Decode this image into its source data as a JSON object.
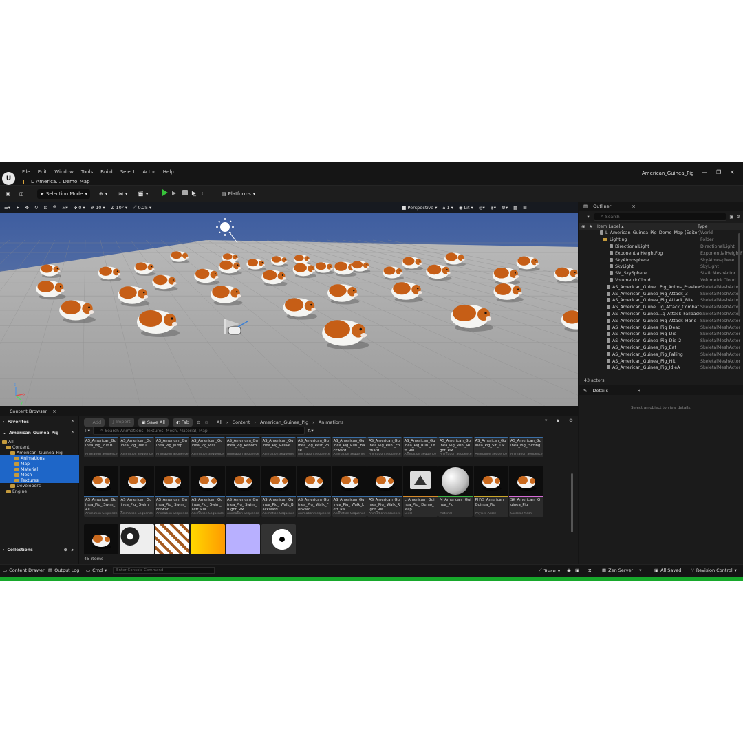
{
  "app": {
    "logo": "U",
    "menu": [
      "File",
      "Edit",
      "Window",
      "Tools",
      "Build",
      "Select",
      "Actor",
      "Help"
    ],
    "map_tab": "L_America..._Demo_Map",
    "window_title": "American_Guinea_Pig",
    "window_controls": [
      "—",
      "❐",
      "✕"
    ]
  },
  "toolbar": {
    "selection_mode": "Selection Mode",
    "platforms": "Platforms"
  },
  "viewport": {
    "snap_rotate": "0",
    "snap_grid": "10",
    "snap_angle": "10°",
    "snap_scale": "0.25",
    "perspective": "Perspective",
    "lit": "Lit",
    "camera_speed": "1"
  },
  "outliner": {
    "tab": "Outliner",
    "search_placeholder": "Search",
    "col_label": "Item Label ▴",
    "col_type": "Type",
    "rows": [
      {
        "label": "L_American_Guinea_Pig_Demo_Map (Editor)",
        "type": "World",
        "indent": 0
      },
      {
        "label": "Lighting",
        "type": "Folder",
        "indent": 1
      },
      {
        "label": "DirectionalLight",
        "type": "DirectionalLight",
        "indent": 2
      },
      {
        "label": "ExponentialHeightFog",
        "type": "ExponentialHeightF",
        "indent": 2
      },
      {
        "label": "SkyAtmosphere",
        "type": "SkyAtmosphere",
        "indent": 2
      },
      {
        "label": "SkyLight",
        "type": "SkyLight",
        "indent": 2
      },
      {
        "label": "SM_SkySphere",
        "type": "StaticMeshActor",
        "indent": 2
      },
      {
        "label": "VolumetricCloud",
        "type": "VolumetricCloud",
        "indent": 2
      },
      {
        "label": "AS_American_Guine...Pig_Anims_Preview",
        "type": "SkeletalMeshActor",
        "indent": 1
      },
      {
        "label": "AS_American_Guinea_Pig_Attack_3",
        "type": "SkeletalMeshActor",
        "indent": 1
      },
      {
        "label": "AS_American_Guinea_Pig_Attack_Bite",
        "type": "SkeletalMeshActor",
        "indent": 1
      },
      {
        "label": "AS_American_Guine...ig_Attack_Combat",
        "type": "SkeletalMeshActor",
        "indent": 1
      },
      {
        "label": "AS_American_Guinea...g_Attack_Fallback",
        "type": "SkeletalMeshActor",
        "indent": 1
      },
      {
        "label": "AS_American_Guinea_Pig_Attack_Hand",
        "type": "SkeletalMeshActor",
        "indent": 1
      },
      {
        "label": "AS_American_Guinea_Pig_Dead",
        "type": "SkeletalMeshActor",
        "indent": 1
      },
      {
        "label": "AS_American_Guinea_Pig_Die",
        "type": "SkeletalMeshActor",
        "indent": 1
      },
      {
        "label": "AS_American_Guinea_Pig_Die_2",
        "type": "SkeletalMeshActor",
        "indent": 1
      },
      {
        "label": "AS_American_Guinea_Pig_Eat",
        "type": "SkeletalMeshActor",
        "indent": 1
      },
      {
        "label": "AS_American_Guinea_Pig_Falling",
        "type": "SkeletalMeshActor",
        "indent": 1
      },
      {
        "label": "AS_American_Guinea_Pig_Hit",
        "type": "SkeletalMeshActor",
        "indent": 1
      },
      {
        "label": "AS_American_Guinea_Pig_IdleA",
        "type": "SkeletalMeshActor",
        "indent": 1
      }
    ],
    "count": "43 actors"
  },
  "details": {
    "tab": "Details",
    "empty_text": "Select an object to view details."
  },
  "content_browser": {
    "tab": "Content Browser",
    "add": "Add",
    "import": "Import",
    "save_all": "Save All",
    "fab": "Fab",
    "breadcrumb": [
      "All",
      "Content",
      "American_Guinea_Pig",
      "Animations"
    ],
    "search_placeholder": "Search Animations, Textures, Mesh, Material, Map",
    "favorites": "Favorites",
    "project": "American_Guinea_Pig",
    "tree": [
      {
        "label": "All",
        "indent": 0,
        "sel": false
      },
      {
        "label": "Content",
        "indent": 1,
        "sel": false
      },
      {
        "label": "American_Guinea_Pig",
        "indent": 2,
        "sel": false
      },
      {
        "label": "Animations",
        "indent": 3,
        "sel": true
      },
      {
        "label": "Map",
        "indent": 3,
        "sel": true
      },
      {
        "label": "Material",
        "indent": 3,
        "sel": true
      },
      {
        "label": "Mesh",
        "indent": 3,
        "sel": true
      },
      {
        "label": "Textures",
        "indent": 3,
        "sel": true
      },
      {
        "label": "Developers",
        "indent": 2,
        "sel": false
      },
      {
        "label": "Engine",
        "indent": 1,
        "sel": false
      }
    ],
    "collections": "Collections",
    "item_count": "45 items",
    "row1": [
      {
        "name": "AS_American_Guinea_Pig_Idle B",
        "type": "Animation Sequence"
      },
      {
        "name": "AS_American_Guinea_Pig_Idle C",
        "type": "Animation Sequence"
      },
      {
        "name": "AS_American_Guinea_Pig_Jump",
        "type": "Animation Sequence"
      },
      {
        "name": "AS_American_Guinea_Pig_Piss",
        "type": "Animation Sequence"
      },
      {
        "name": "AS_American_Guinea_Pig_Reborn",
        "type": "Animation Sequence"
      },
      {
        "name": "AS_American_Guinea_Pig_Relive",
        "type": "Animation Sequence"
      },
      {
        "name": "AS_American_Guinea_Pig_Rest_Pose",
        "type": "Animation Sequence"
      },
      {
        "name": "AS_American_Guinea_Pig_Run _Backward",
        "type": "Animation Sequence"
      },
      {
        "name": "AS_American_Guinea_Pig_Run _Forward",
        "type": "Animation Sequence"
      },
      {
        "name": "AS_American_Guinea_Pig_Run _Left_RM",
        "type": "Animation Sequence"
      },
      {
        "name": "AS_American_Guinea_Pig_Run _Right_RM",
        "type": "Animation Sequence"
      },
      {
        "name": "AS_American_Guinea_Pig_Sit_ UP",
        "type": "Animation Sequence"
      },
      {
        "name": "AS_American_Guinea_Pig_ Sitting",
        "type": "Animation Sequence"
      }
    ],
    "row2": [
      {
        "name": "AS_American_Guinea_Pig_ Swim_All",
        "type": "Animation Sequence"
      },
      {
        "name": "AS_American_Guinea_Pig_ Swim_...",
        "type": "Animation Sequence"
      },
      {
        "name": "AS_American_Guinea_Pig_ Swim_Forwar...",
        "type": "Animation Sequence"
      },
      {
        "name": "AS_American_Guinea_Pig_ Swim_Left_RM",
        "type": "Animation Sequence"
      },
      {
        "name": "AS_American_Guinea_Pig_ Swim_Right_RM",
        "type": "Animation Sequence"
      },
      {
        "name": "AS_American_Guinea_Pig_ Walk_Backward",
        "type": "Animation Sequence"
      },
      {
        "name": "AS_American_Guinea_Pig_ Walk_Forward",
        "type": "Animation Sequence"
      },
      {
        "name": "AS_American_Guinea_Pig_ Walk_Left_RM",
        "type": "Animation Sequence"
      },
      {
        "name": "AS_American_Guinea_Pig_ Walk_Right_RM",
        "type": "Animation Sequence"
      },
      {
        "name": "L_American_ Guinea_Pig_ Demo_Map",
        "type": "Level"
      },
      {
        "name": "M_American_ Guinea_Pig",
        "type": "Material"
      },
      {
        "name": "PHYS_American _Guinea_Pig",
        "type": "Physics Asset"
      },
      {
        "name": "SK_American_ Guinea_Pig",
        "type": "Skeletal Mesh"
      }
    ]
  },
  "statusbar": {
    "content_drawer": "Content Drawer",
    "output_log": "Output Log",
    "cmd": "Cmd",
    "console_placeholder": "Enter Console Command",
    "trace": "Trace",
    "zen_server": "Zen Server",
    "all_saved": "All Saved",
    "revision_control": "Revision Control"
  },
  "colors": {
    "accent_green": "#17a82b",
    "selection_blue": "#1e66c8",
    "folder": "#c49a3c"
  }
}
